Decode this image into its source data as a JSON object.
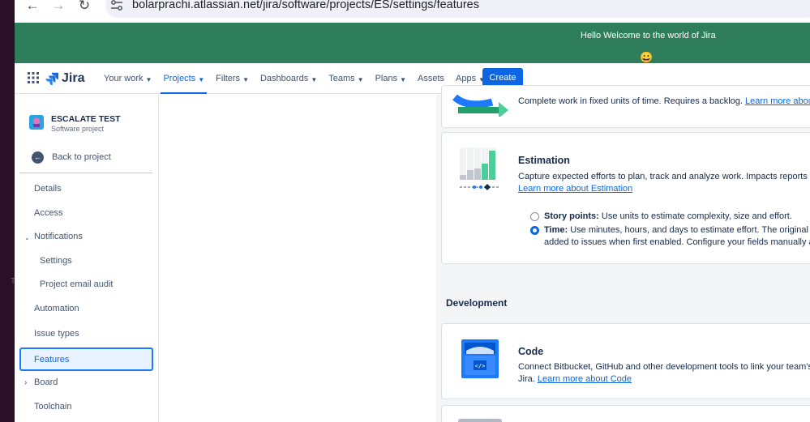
{
  "browser": {
    "url": "bolarprachi.atlassian.net/jira/software/projects/ES/settings/features",
    "back_icon": "arrow-left-icon",
    "forward_icon": "arrow-right-icon",
    "reload_icon": "reload-icon"
  },
  "banner": {
    "text": "Hello Welcome to the world of Jira",
    "emoji": "😀",
    "color": "#2e7d5b"
  },
  "topnav": {
    "logo": "Jira",
    "items": [
      {
        "label": "Your work",
        "dropdown": true
      },
      {
        "label": "Projects",
        "dropdown": true,
        "active": true
      },
      {
        "label": "Filters",
        "dropdown": true
      },
      {
        "label": "Dashboards",
        "dropdown": true
      },
      {
        "label": "Teams",
        "dropdown": true
      },
      {
        "label": "Plans",
        "dropdown": true
      },
      {
        "label": "Assets",
        "dropdown": false
      },
      {
        "label": "Apps",
        "dropdown": true
      }
    ],
    "create_label": "Create",
    "accent": "#0c66e4"
  },
  "sidebar": {
    "project_name": "ESCALATE TEST",
    "project_type": "Software project",
    "back_label": "Back to project",
    "items": [
      {
        "label": "Details"
      },
      {
        "label": "Access"
      },
      {
        "label": "Notifications",
        "expanded": true
      },
      {
        "label": "Settings",
        "sub": true
      },
      {
        "label": "Project email audit",
        "sub": true
      },
      {
        "label": "Automation"
      },
      {
        "label": "Issue types"
      },
      {
        "label": "Features",
        "selected": true
      },
      {
        "label": "Board",
        "collapsed": true
      },
      {
        "label": "Toolchain"
      }
    ]
  },
  "main": {
    "sprints_card": {
      "description": "Complete work in fixed units of time. Requires a backlog.",
      "link": "Learn more about"
    },
    "estimation_card": {
      "title": "Estimation",
      "description": "Capture expected efforts to plan, track and analyze work. Impacts reports an",
      "link": "Learn more about Estimation",
      "options": [
        {
          "label": "Story points:",
          "description": "Use units to estimate complexity, size and effort.",
          "checked": false
        },
        {
          "label": "Time:",
          "description": "Use minutes, hours, and days to estimate effort. The original es",
          "description2": "added to issues when first enabled. Configure your fields manually af",
          "checked": true
        }
      ]
    },
    "development_section": {
      "title": "Development",
      "code_card": {
        "title": "Code",
        "description": "Connect Bitbucket, GitHub and other development tools to link your team's r",
        "description2_prefix": "Jira.",
        "link": "Learn more about Code"
      }
    }
  }
}
